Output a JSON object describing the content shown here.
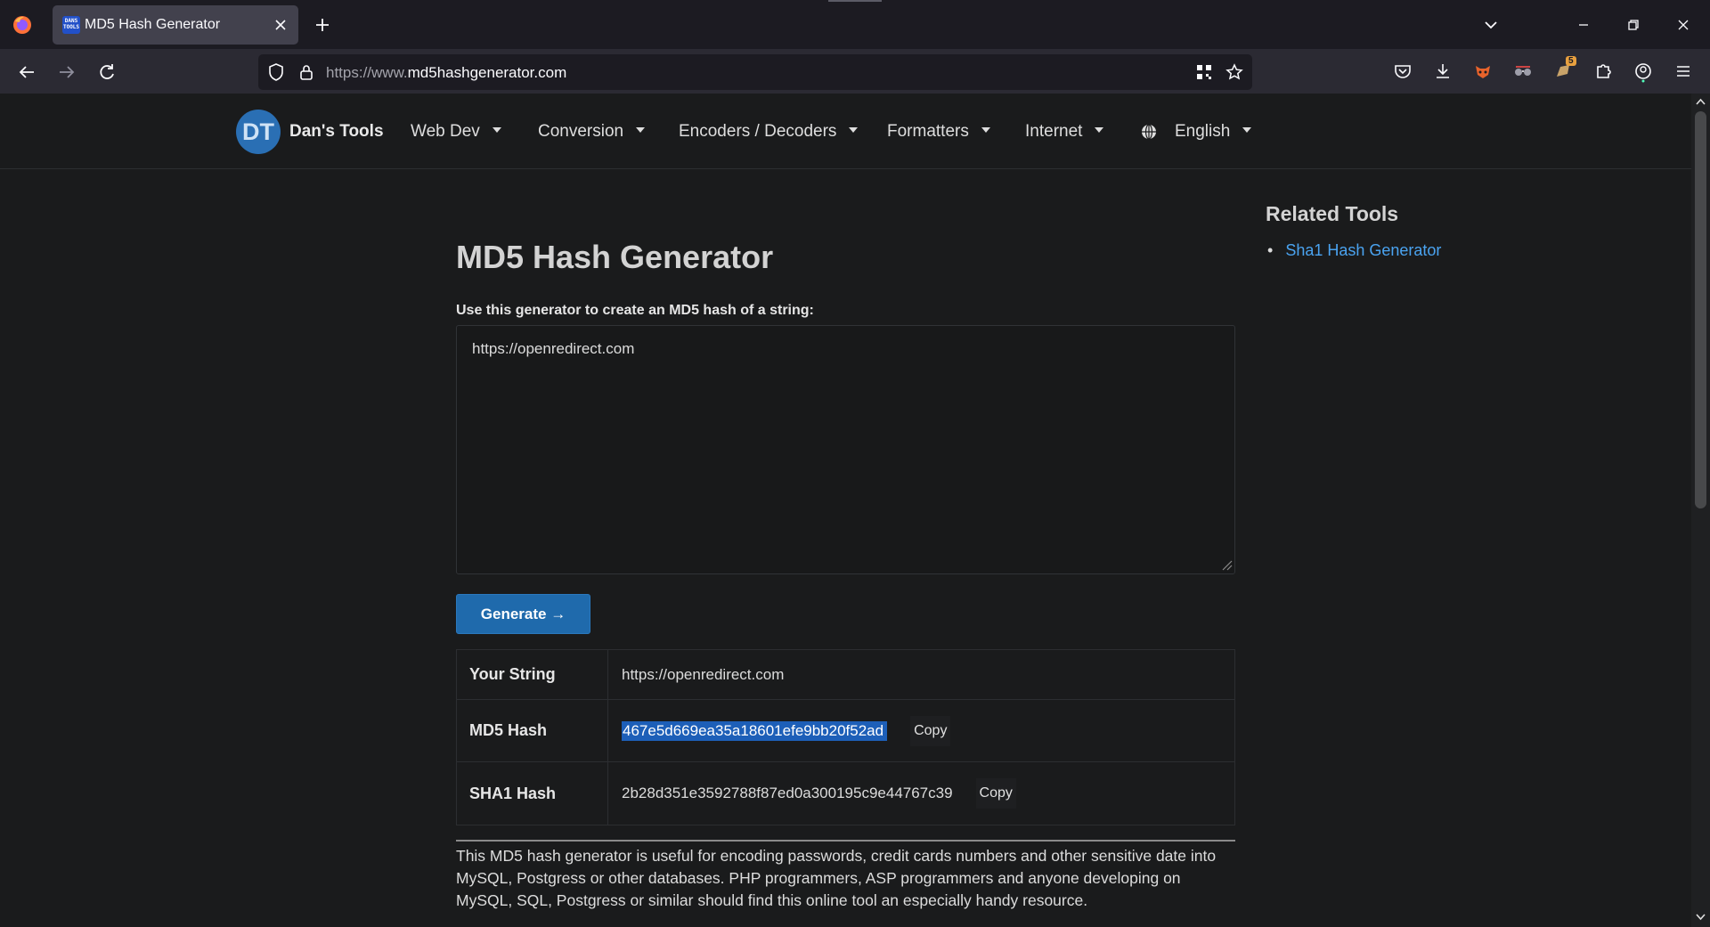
{
  "browser": {
    "tab_title": "MD5 Hash Generator",
    "tab_favicon_text": "DANS TOOLS",
    "url_prefix": "https://www.",
    "url_domain": "md5hashgenerator.com",
    "extension_badge": "5"
  },
  "site": {
    "brand_initials": "DT",
    "brand_name": "Dan's Tools",
    "menu": [
      {
        "label": "Web Dev"
      },
      {
        "label": "Conversion"
      },
      {
        "label": "Encoders / Decoders"
      },
      {
        "label": "Formatters"
      },
      {
        "label": "Internet"
      },
      {
        "label": "English"
      }
    ]
  },
  "main": {
    "title": "MD5 Hash Generator",
    "input_label": "Use this generator to create an MD5 hash of a string:",
    "input_value": "https://openredirect.com",
    "generate_label": "Generate →",
    "results": {
      "string_label": "Your String",
      "string_value": "https://openredirect.com",
      "md5_label": "MD5 Hash",
      "md5_value": "467e5d669ea35a18601efe9bb20f52ad",
      "sha1_label": "SHA1 Hash",
      "sha1_value": "2b28d351e3592788f87ed0a300195c9e44767c39",
      "copy_label": "Copy"
    },
    "description": "This MD5 hash generator is useful for encoding passwords, credit cards numbers and other sensitive date into MySQL, Postgress or other databases. PHP programmers, ASP programmers and anyone developing on MySQL, SQL, Postgress or similar should find this online tool an especially handy resource."
  },
  "sidebar": {
    "title": "Related Tools",
    "links": [
      {
        "label": "Sha1 Hash Generator"
      }
    ]
  },
  "colors": {
    "accent": "#1f6aac",
    "link": "#4aa3f0",
    "page_bg": "#1a1b1c",
    "chrome_bg": "#1c1b22",
    "toolbar_bg": "#2b2a33"
  }
}
